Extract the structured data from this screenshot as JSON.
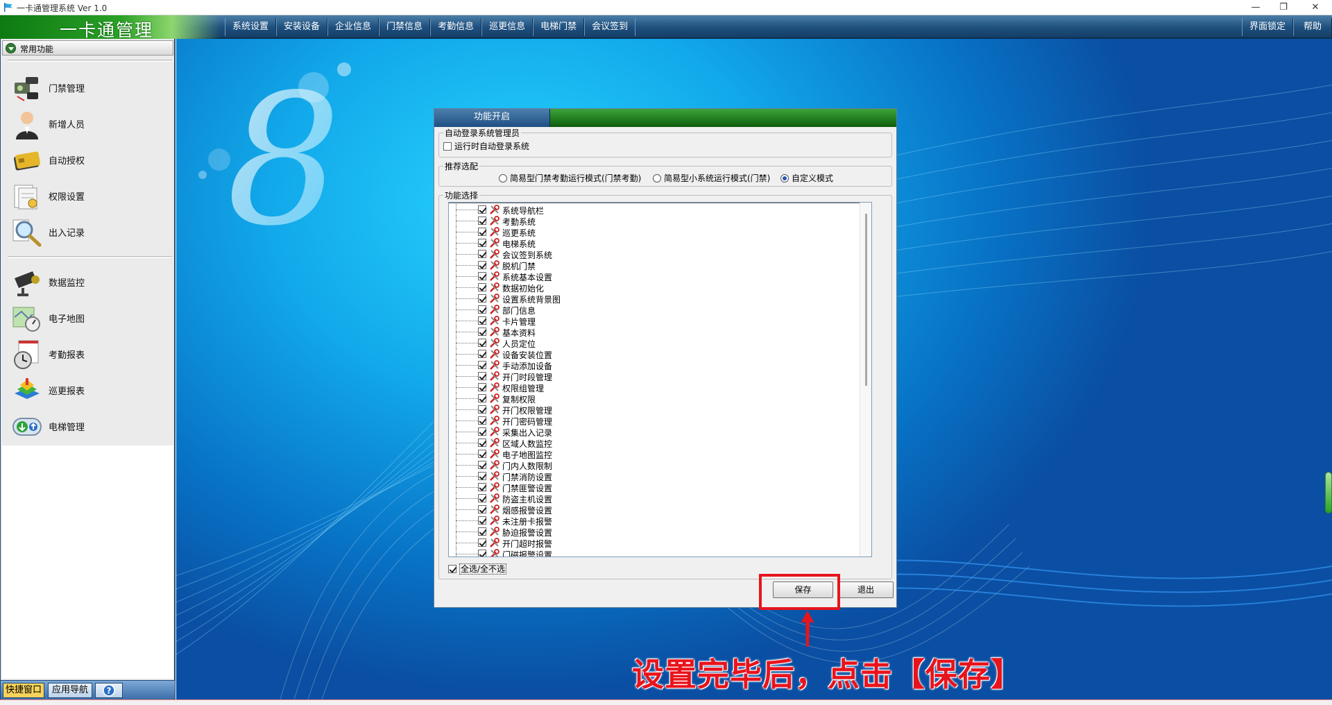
{
  "window": {
    "title": "一卡通管理系统 Ver 1.0",
    "minimize": "—",
    "restore": "❐",
    "close": "✕"
  },
  "logo_text": "一卡通管理",
  "menu": [
    "系统设置",
    "安装设备",
    "企业信息",
    "门禁信息",
    "考勤信息",
    "巡更信息",
    "电梯门禁",
    "会议签到"
  ],
  "right_menu": [
    "界面锁定",
    "帮助"
  ],
  "sidebar": {
    "header": "常用功能",
    "items": [
      {
        "label": "门禁管理",
        "icon": "access-control-icon"
      },
      {
        "label": "新增人员",
        "icon": "person-icon"
      },
      {
        "label": "自动授权",
        "icon": "card-icon"
      },
      {
        "label": "权限设置",
        "icon": "document-settings-icon"
      },
      {
        "label": "出入记录",
        "icon": "magnifier-icon"
      },
      {
        "label": "数据监控",
        "icon": "camera-icon"
      },
      {
        "label": "电子地图",
        "icon": "map-icon"
      },
      {
        "label": "考勤报表",
        "icon": "clock-report-icon"
      },
      {
        "label": "巡更报表",
        "icon": "patrol-report-icon"
      },
      {
        "label": "电梯管理",
        "icon": "elevator-icon"
      }
    ],
    "tabs": {
      "shortcut": "快捷窗口",
      "nav": "应用导航"
    }
  },
  "dialog": {
    "tab": "功能开启",
    "autologin_group": "自动登录系统管理员",
    "autologin_option": "运行时自动登录系统",
    "recommend_group": "推荐选配",
    "modes": [
      {
        "label": "简易型门禁考勤运行模式(门禁考勤)",
        "selected": false
      },
      {
        "label": "简易型小系统运行模式(门禁)",
        "selected": false
      },
      {
        "label": "自定义模式",
        "selected": true
      }
    ],
    "feature_group": "功能选择",
    "features": [
      "系统导航栏",
      "考勤系统",
      "巡更系统",
      "电梯系统",
      "会议签到系统",
      "脱机门禁",
      "系统基本设置",
      "数据初始化",
      "设置系统背景图",
      "部门信息",
      "卡片管理",
      "基本资料",
      "人员定位",
      "设备安装位置",
      "手动添加设备",
      "开门时段管理",
      "权限组管理",
      "复制权限",
      "开门权限管理",
      "开门密码管理",
      "采集出入记录",
      "区域人数监控",
      "电子地图监控",
      "门内人数限制",
      "门禁消防设置",
      "门禁匪警设置",
      "防盗主机设置",
      "烟感报警设置",
      "未注册卡报警",
      "胁迫报警设置",
      "开门超时报警",
      "门磁报警设置"
    ],
    "select_all": "全选/全不选",
    "save": "保存",
    "exit": "退出"
  },
  "annotation": "设置完毕后，点击【保存】",
  "colors": {
    "accent_red": "#e8141d",
    "menu_blue": "#1e4f7e",
    "logo_green": "#2aa126"
  }
}
